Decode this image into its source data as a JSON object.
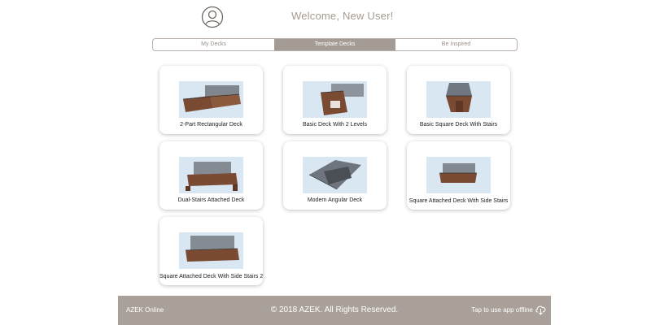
{
  "header": {
    "welcome": "Welcome, New User!",
    "avatar_icon": "user-circle-icon"
  },
  "tabs": [
    {
      "label": "My Decks",
      "active": false
    },
    {
      "label": "Template Decks",
      "active": true
    },
    {
      "label": "Be Inspired",
      "active": false
    }
  ],
  "templates": [
    {
      "label": "2-Part Rectangular Deck",
      "icon": "deck-thumbnail"
    },
    {
      "label": "Basic Deck With 2 Levels",
      "icon": "deck-thumbnail"
    },
    {
      "label": "Basic Square Deck With Stairs",
      "icon": "deck-thumbnail"
    },
    {
      "label": "Dual-Stairs Attached Deck",
      "icon": "deck-thumbnail"
    },
    {
      "label": "Modern Angular Deck",
      "icon": "deck-thumbnail"
    },
    {
      "label": "Square Attached Deck With Side Stairs",
      "icon": "deck-thumbnail"
    },
    {
      "label": "Square Attached Deck With Side Stairs 2",
      "icon": "deck-thumbnail"
    }
  ],
  "footer": {
    "left": "AZEK Online",
    "center": "© 2018 AZEK. All Rights Reserved.",
    "right": "Tap to use app offline",
    "cloud_icon": "cloud-download-icon"
  },
  "colors": {
    "accent": "#a39b94",
    "footer_bg": "#a8a099",
    "welcome_text": "#a69a8f",
    "thumb_bg": "#d9e7f2",
    "deck_wood": "#7a4a32"
  }
}
